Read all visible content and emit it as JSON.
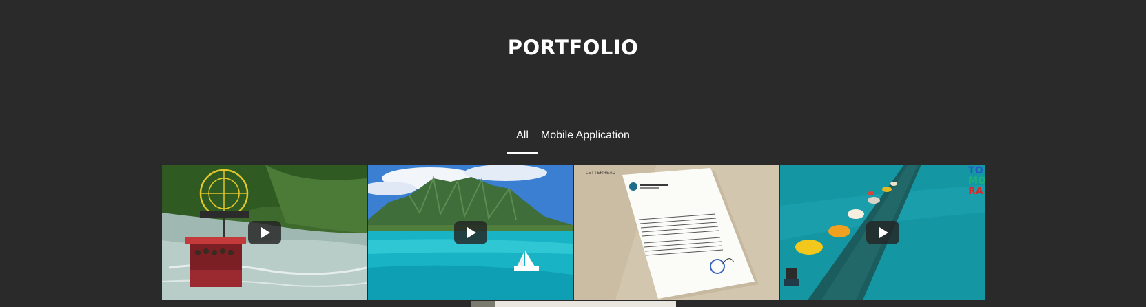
{
  "section": {
    "title": "PORTFOLIO"
  },
  "filters": {
    "items": [
      {
        "label": "All",
        "active": true
      },
      {
        "label": "Mobile Application",
        "active": false
      }
    ]
  },
  "tiles": [
    {
      "name": "aerial-cable-car",
      "type": "video",
      "icon": "play-icon"
    },
    {
      "name": "tropical-island-lagoon",
      "type": "video",
      "icon": "play-icon"
    },
    {
      "name": "letterhead-mockup",
      "type": "image",
      "caption": "LETTERHEAD"
    },
    {
      "name": "flooded-road-cars",
      "type": "video",
      "icon": "play-icon",
      "overlay_text": [
        "TO",
        "MO",
        "RA"
      ]
    }
  ],
  "colors": {
    "background": "#2a2a2a",
    "text": "#ffffff",
    "active_underline": "#ffffff"
  }
}
